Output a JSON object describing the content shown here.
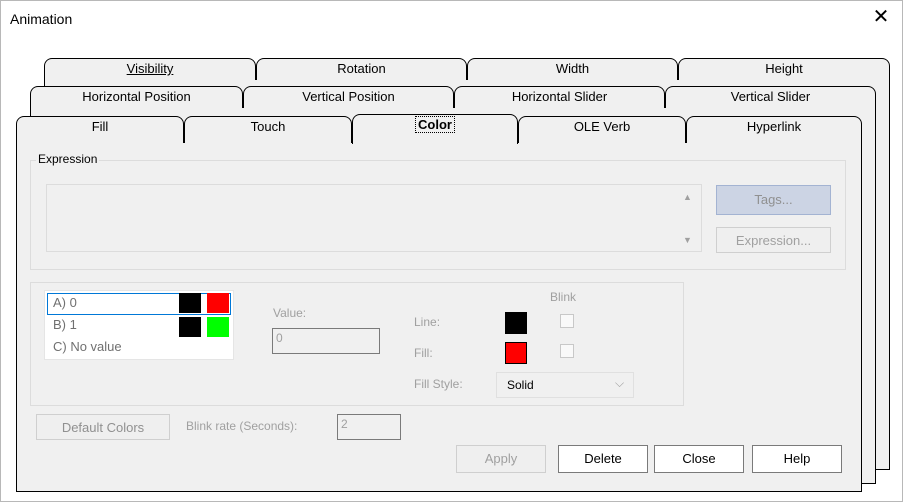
{
  "window": {
    "title": "Animation",
    "close_glyph": "✕"
  },
  "tabs": {
    "row1": [
      "Visibility",
      "Rotation",
      "Width",
      "Height"
    ],
    "row2": [
      "Horizontal Position",
      "Vertical Position",
      "Horizontal Slider",
      "Vertical Slider"
    ],
    "row3": [
      "Fill",
      "Touch",
      "Color",
      "OLE Verb",
      "Hyperlink"
    ],
    "selected": "Color"
  },
  "expression": {
    "group_label": "Expression",
    "value": "",
    "scroll_up": "▲",
    "scroll_down": "▼",
    "tags_button": "Tags...",
    "expression_button": "Expression..."
  },
  "color_list": {
    "items": [
      {
        "label": "A) 0",
        "line_color": "#000000",
        "fill_color": "#ff0000"
      },
      {
        "label": "B) 1",
        "line_color": "#000000",
        "fill_color": "#00ff00"
      },
      {
        "label": "C) No value"
      }
    ]
  },
  "value_label": "Value:",
  "value_field": "0",
  "blink_label": "Blink",
  "line_label": "Line:",
  "fill_label": "Fill:",
  "line_color": "#000000",
  "fill_color": "#ff0000",
  "fill_style_label": "Fill Style:",
  "fill_style_value": "Solid",
  "default_colors_button": "Default Colors",
  "blink_rate_label": "Blink rate (Seconds):",
  "blink_rate_value": "2",
  "buttons": {
    "apply": "Apply",
    "delete": "Delete",
    "close": "Close",
    "help": "Help"
  }
}
